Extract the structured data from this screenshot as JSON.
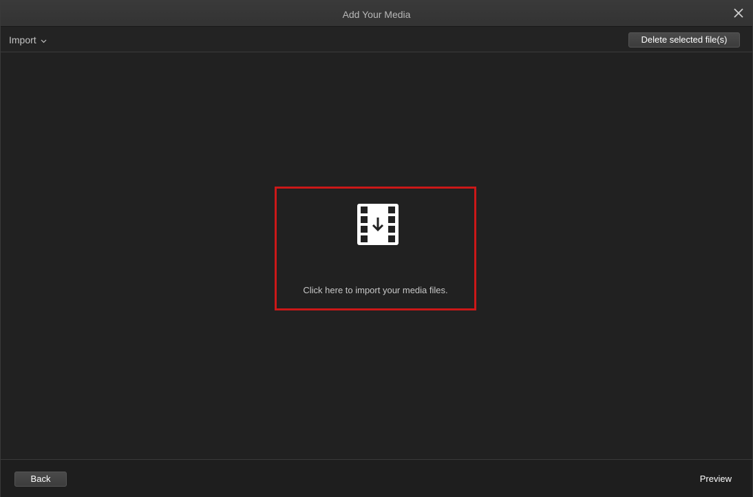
{
  "window": {
    "title": "Add Your Media"
  },
  "toolbar": {
    "import_label": "Import",
    "delete_label": "Delete selected file(s)"
  },
  "dropzone": {
    "icon": "film-import-icon",
    "text": "Click here to import your media files.",
    "highlight_color": "#cc1818"
  },
  "footer": {
    "back_label": "Back",
    "preview_label": "Preview"
  },
  "icons": {
    "close": "close-icon",
    "import_chevron": "chevron-down-icon"
  }
}
